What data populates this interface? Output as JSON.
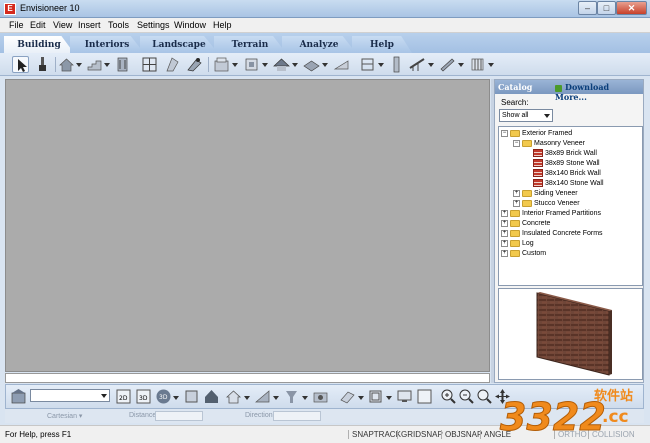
{
  "window": {
    "title": "Envisioneer 10",
    "icon_letter": "E"
  },
  "window_controls": {
    "minimize": "–",
    "maximize": "□",
    "close": "✕"
  },
  "menu": [
    "File",
    "Edit",
    "View",
    "Insert",
    "Tools",
    "Settings",
    "Window",
    "Help"
  ],
  "tabs": [
    {
      "label": "Building",
      "active": true
    },
    {
      "label": "Interiors",
      "active": false
    },
    {
      "label": "Landscape",
      "active": false
    },
    {
      "label": "Terrain",
      "active": false
    },
    {
      "label": "Analyze",
      "active": false
    },
    {
      "label": "Help",
      "active": false
    }
  ],
  "catalog": {
    "title": "Catalog",
    "download_label": "Download More...",
    "search_label": "Search:",
    "search_value": "Show all",
    "tree": [
      {
        "label": "Exterior Framed",
        "depth": 0,
        "expanded": true,
        "kind": "folder"
      },
      {
        "label": "Masonry Veneer",
        "depth": 1,
        "expanded": true,
        "kind": "folder"
      },
      {
        "label": "38x89  Brick Wall",
        "depth": 2,
        "kind": "item"
      },
      {
        "label": "38x89 Stone Wall",
        "depth": 2,
        "kind": "item"
      },
      {
        "label": "38x140 Brick Wall",
        "depth": 2,
        "kind": "item"
      },
      {
        "label": "38x140 Stone Wall",
        "depth": 2,
        "kind": "item"
      },
      {
        "label": "Siding Veneer",
        "depth": 1,
        "expanded": false,
        "kind": "folder"
      },
      {
        "label": "Stucco Veneer",
        "depth": 1,
        "expanded": false,
        "kind": "folder"
      },
      {
        "label": "Interior Framed Partitions",
        "depth": 0,
        "expanded": false,
        "kind": "folder"
      },
      {
        "label": "Concrete",
        "depth": 0,
        "expanded": false,
        "kind": "folder"
      },
      {
        "label": "Insulated Concrete Forms",
        "depth": 0,
        "expanded": false,
        "kind": "folder"
      },
      {
        "label": "Log",
        "depth": 0,
        "expanded": false,
        "kind": "folder"
      },
      {
        "label": "Custom",
        "depth": 0,
        "expanded": false,
        "kind": "folder"
      }
    ]
  },
  "coord_bar": {
    "mode": "Cartesian",
    "distance_label": "Distance",
    "direction_label": "Direction"
  },
  "status": {
    "help_text": "For Help, press F1",
    "snaps": [
      {
        "label": "SNAPTRACK",
        "active": true
      },
      {
        "label": "GRIDSNAP",
        "active": true
      },
      {
        "label": "OBJSNAP",
        "active": true
      },
      {
        "label": "ANGLE",
        "active": true
      },
      {
        "label": "ORTHO",
        "active": false
      },
      {
        "label": "COLLISION",
        "active": false
      }
    ]
  },
  "watermark": {
    "text": "3322",
    "suffix": ".cc",
    "site": "软件站"
  },
  "colors": {
    "accent": "#a3c0e3",
    "canvas": "#ababab",
    "brick": "#c0392b",
    "watermark_orange": "#f08a1c"
  }
}
